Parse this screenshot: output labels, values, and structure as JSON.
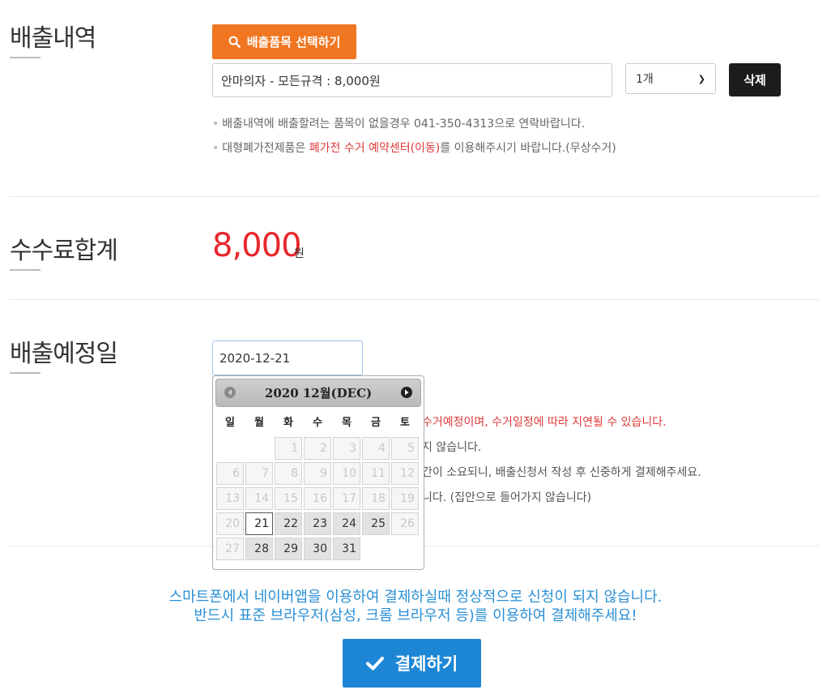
{
  "sections": {
    "items_title": "배출내역",
    "fee_title": "수수료합계",
    "date_title": "배출예정일"
  },
  "items": {
    "select_button": "배출품목 선택하기",
    "item_value": "안마의자 - 모든규격 : 8,000원",
    "quantity": "1개",
    "delete_button": "삭제",
    "note1": "배출내역에 배출할려는 품목이 없을경우 041-350-4313으로 연락바랍니다.",
    "note2_prefix": "대형폐가전제품은 ",
    "note2_link": "폐가전 수거 예약센터(이동)",
    "note2_suffix": "를 이용해주시기 바랍니다.(무상수거)"
  },
  "fee": {
    "amount": "8,000",
    "unit": "원"
  },
  "schedule": {
    "date_value": "2020-12-21",
    "note1_visible": "수거예정이며, 수거일정에 따라 지연될 수 있습니다.",
    "note2_visible": "지 않습니다.",
    "note3_visible": "간이 소요되니, 배출신청서 작성 후 신중하게 결제해주세요.",
    "note4_visible": "니다. (집안으로 들어가지 않습니다)"
  },
  "datepicker": {
    "title": "2020 12월(DEC)",
    "weekdays": [
      "일",
      "월",
      "화",
      "수",
      "목",
      "금",
      "토"
    ],
    "weeks": [
      [
        "",
        "",
        "1",
        "2",
        "3",
        "4",
        "5"
      ],
      [
        "6",
        "7",
        "8",
        "9",
        "10",
        "11",
        "12"
      ],
      [
        "13",
        "14",
        "15",
        "16",
        "17",
        "18",
        "19"
      ],
      [
        "20",
        "21",
        "22",
        "23",
        "24",
        "25",
        "26"
      ],
      [
        "27",
        "28",
        "29",
        "30",
        "31",
        "",
        ""
      ]
    ],
    "today": "21",
    "available": [
      "21",
      "22",
      "23",
      "24",
      "25",
      "28",
      "29",
      "30",
      "31"
    ]
  },
  "notice": {
    "line1": "스마트폰에서 네이버앱을 이용하여 결제하실때 정상적으로 신청이 되지 않습니다.",
    "line2": "반드시 표준 브라우저(삼성, 크롬 브라우저 등)를 이용하여 결제해주세요!"
  },
  "pay_button": "결제하기",
  "colors": {
    "orange_button": "#f07621",
    "fee_red": "#e8262b",
    "notice_blue": "#2a8fd6",
    "pay_blue": "#1d87d5"
  }
}
